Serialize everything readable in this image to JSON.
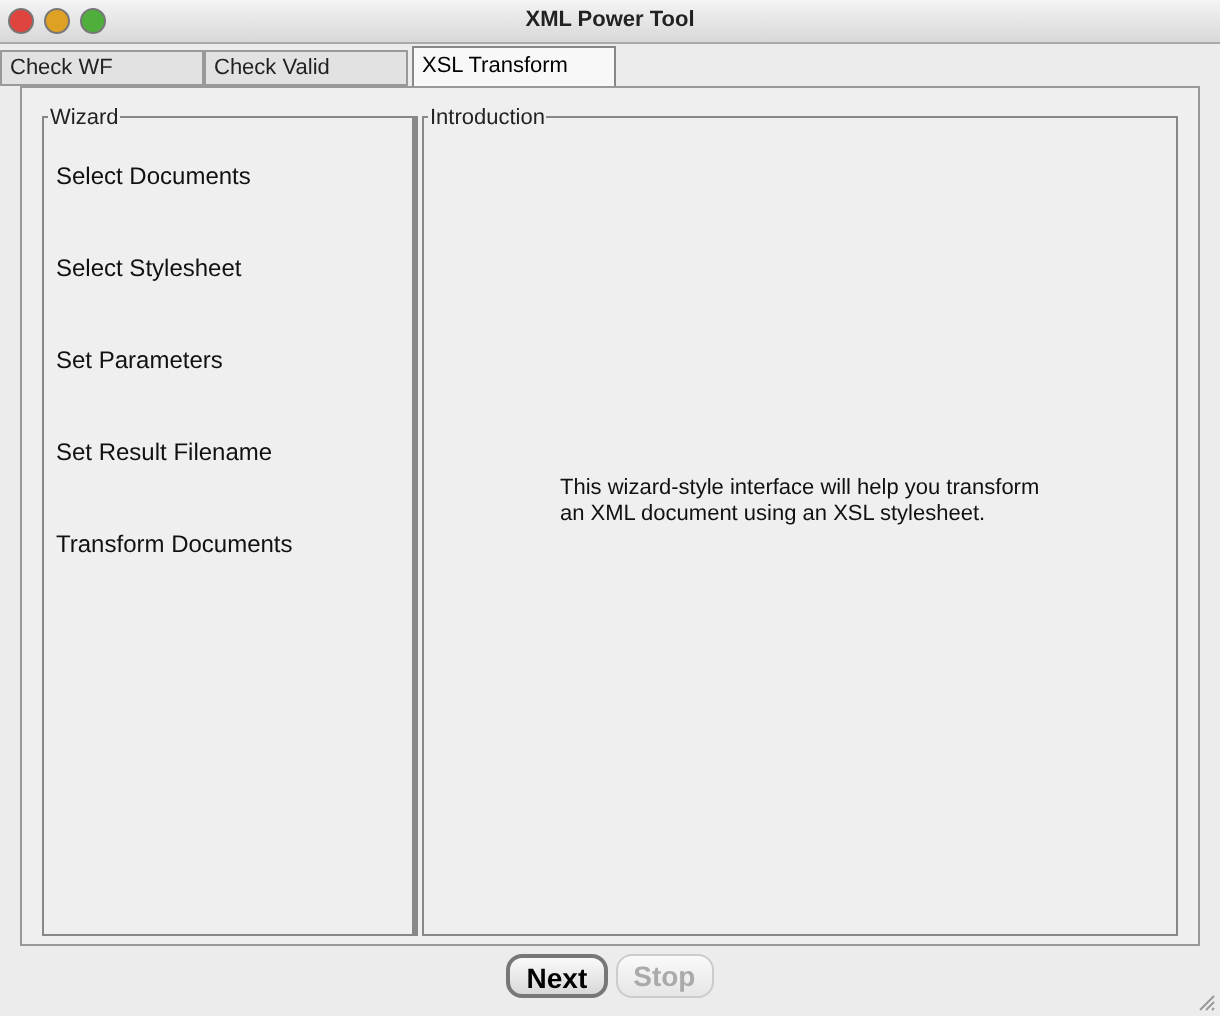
{
  "window": {
    "title": "XML Power Tool"
  },
  "tabs": [
    {
      "label": "Check WF",
      "selected": false
    },
    {
      "label": "Check Valid",
      "selected": false
    },
    {
      "label": "XSL Transform",
      "selected": true
    }
  ],
  "wizard": {
    "title": "Wizard",
    "steps": [
      "Select Documents",
      "Select Stylesheet",
      "Set Parameters",
      "Set Result Filename",
      "Transform Documents"
    ]
  },
  "introduction": {
    "title": "Introduction",
    "text": "This wizard-style interface will help you transform an XML document using an XSL stylesheet."
  },
  "buttons": [
    {
      "label": "Next",
      "disabled": false
    },
    {
      "label": "Stop",
      "disabled": true
    }
  ]
}
